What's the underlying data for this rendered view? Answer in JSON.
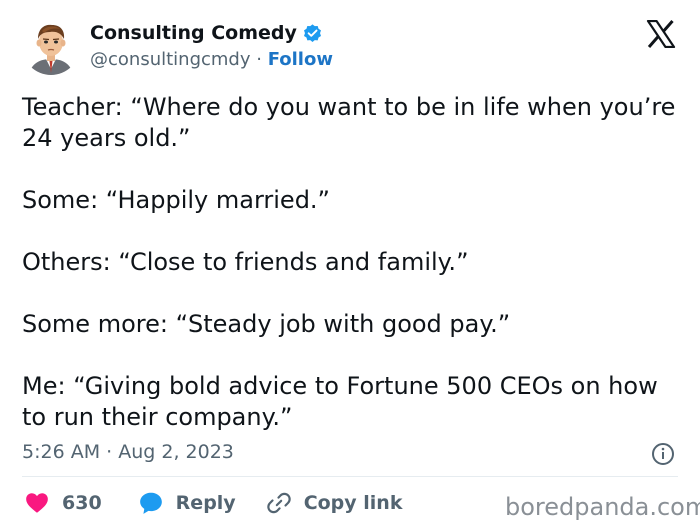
{
  "author": {
    "display_name": "Consulting Comedy",
    "handle": "@consultingcmdy",
    "separator": "·",
    "follow_label": "Follow"
  },
  "tweet": {
    "paragraphs": [
      "Teacher: “Where do you want to be in life when you’re 24 years old.”",
      "Some: “Happily married.”",
      "Others: “Close to friends and family.”",
      "Some more: “Steady job with good pay.”",
      "Me: “Giving bold advice to Fortune 500 CEOs on how to run their company.”"
    ],
    "timestamp": "5:26 AM · Aug 2, 2023"
  },
  "actions": {
    "like_count": "630",
    "reply_label": "Reply",
    "copy_link_label": "Copy link"
  },
  "watermark": "boredpanda.com",
  "icons": {
    "verified": "verified-badge-icon",
    "x_logo": "x-logo-icon",
    "info": "info-icon",
    "like": "heart-icon",
    "reply": "speech-bubble-icon",
    "copy_link": "link-icon"
  },
  "colors": {
    "text": "#0f1419",
    "secondary": "#536471",
    "follow": "#1d75c6",
    "verified": "#1d9bf0",
    "heart": "#f91880",
    "reply_bubble": "#1d9bf0"
  }
}
